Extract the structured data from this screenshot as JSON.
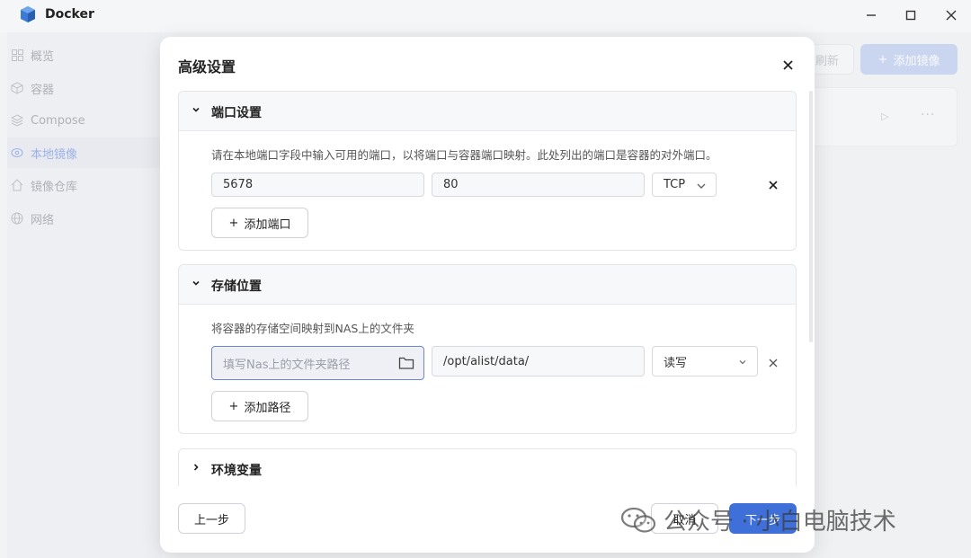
{
  "app": {
    "title": "Docker"
  },
  "window_controls": {
    "minimize": "—",
    "maximize": "☐",
    "close": "✕"
  },
  "sidebar": {
    "items": [
      {
        "label": "概览",
        "icon": "grid-icon"
      },
      {
        "label": "容器",
        "icon": "box-icon"
      },
      {
        "label": "Compose",
        "icon": "layers-icon"
      },
      {
        "label": "本地镜像",
        "icon": "disc-icon",
        "active": true
      },
      {
        "label": "镜像仓库",
        "icon": "home-icon"
      },
      {
        "label": "网络",
        "icon": "globe-icon"
      }
    ]
  },
  "toolbar": {
    "refresh_label": "刷新",
    "add_image_label": "添加镜像"
  },
  "modal": {
    "title": "高级设置",
    "ports": {
      "title": "端口设置",
      "description": "请在本地端口字段中输入可用的端口，以将端口与容器端口映射。此处列出的端口是容器的对外端口。",
      "rows": [
        {
          "local_port": "5678",
          "container_port": "80",
          "protocol": "TCP"
        }
      ],
      "add_label": "添加端口"
    },
    "storage": {
      "title": "存储位置",
      "description": "将容器的存储空间映射到NAS上的文件夹",
      "rows": [
        {
          "nas_path_placeholder": "填写Nas上的文件夹路径",
          "container_path": "/opt/alist/data/",
          "mode": "读写"
        }
      ],
      "add_label": "添加路径"
    },
    "env": {
      "title": "环境变量"
    },
    "footer": {
      "prev_label": "上一步",
      "cancel_label": "取消",
      "next_label": "下一步"
    }
  },
  "watermark": {
    "text": "公众号 · 小白电脑技术"
  },
  "colors": {
    "primary": "#3f6fd9",
    "active_nav": "#6e8fe0",
    "focus_border": "#6e86d6"
  }
}
